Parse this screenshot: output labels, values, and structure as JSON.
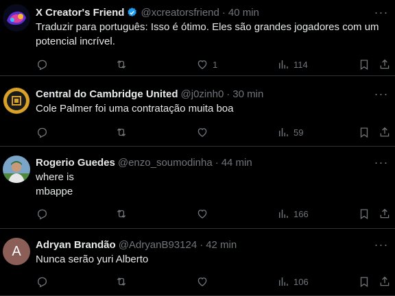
{
  "tweets": [
    {
      "name": "X Creator's Friend",
      "verified": true,
      "handle": "@xcreatorsfriend",
      "time": "40 min",
      "text": "Traduzir para português: Isso é ótimo. Eles são grandes jogadores com um potencial incrível.",
      "replies": "",
      "retweets": "",
      "likes": "1",
      "views": "114"
    },
    {
      "name": "Central do Cambridge United",
      "verified": false,
      "handle": "@j0zinh0",
      "time": "30 min",
      "text": "Cole Palmer foi uma contratação muita boa",
      "replies": "",
      "retweets": "",
      "likes": "",
      "views": "59"
    },
    {
      "name": "Rogerio Guedes",
      "verified": false,
      "handle": "@enzo_soumodinha",
      "time": "44 min",
      "text": "where is\nmbappe",
      "replies": "",
      "retweets": "",
      "likes": "",
      "views": "166"
    },
    {
      "name": "Adryan Brandão",
      "verified": false,
      "handle": "@AdryanB93124",
      "time": "42 min",
      "text": "Nunca serão yuri Alberto",
      "replies": "",
      "retweets": "",
      "likes": "",
      "views": "106",
      "avatar_letter": "A"
    }
  ],
  "colors": {
    "background": "#000000",
    "text": "#e7e9ea",
    "muted": "#71767b",
    "divider": "#2f3336",
    "verified": "#1d9bf0",
    "avatar_letter_bg": "#8b5e57"
  },
  "icons": {
    "reply": "reply-icon",
    "retweet": "retweet-icon",
    "like": "heart-icon",
    "views": "views-icon",
    "bookmark": "bookmark-icon",
    "share": "share-icon",
    "more": "more-icon"
  }
}
